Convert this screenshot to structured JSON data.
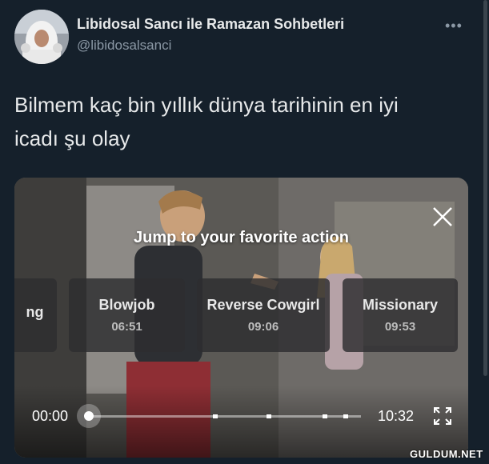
{
  "tweet": {
    "display_name": "Libidosal Sancı ile Ramazan Sohbetleri",
    "handle": "@libidosalsanci",
    "more_icon": "more-icon",
    "text_line1": "Bilmem kaç bin yıllık dünya tarihinin en iyi",
    "text_line2": "icadı şu olay"
  },
  "video": {
    "overlay_title": "Jump to your favorite action",
    "chapters": [
      {
        "label": "ng",
        "time": ""
      },
      {
        "label": "Blowjob",
        "time": "06:51"
      },
      {
        "label": "Reverse Cowgirl",
        "time": "09:06"
      },
      {
        "label": "Missionary",
        "time": "09:53"
      }
    ],
    "current_time": "00:00",
    "total_time": "10:32",
    "progress": 0,
    "icons": [
      "close-icon",
      "fullscreen-icon"
    ]
  },
  "watermark": "GULDUM.NET",
  "colors": {
    "background": "#15202b",
    "secondary_text": "#8b98a5"
  }
}
